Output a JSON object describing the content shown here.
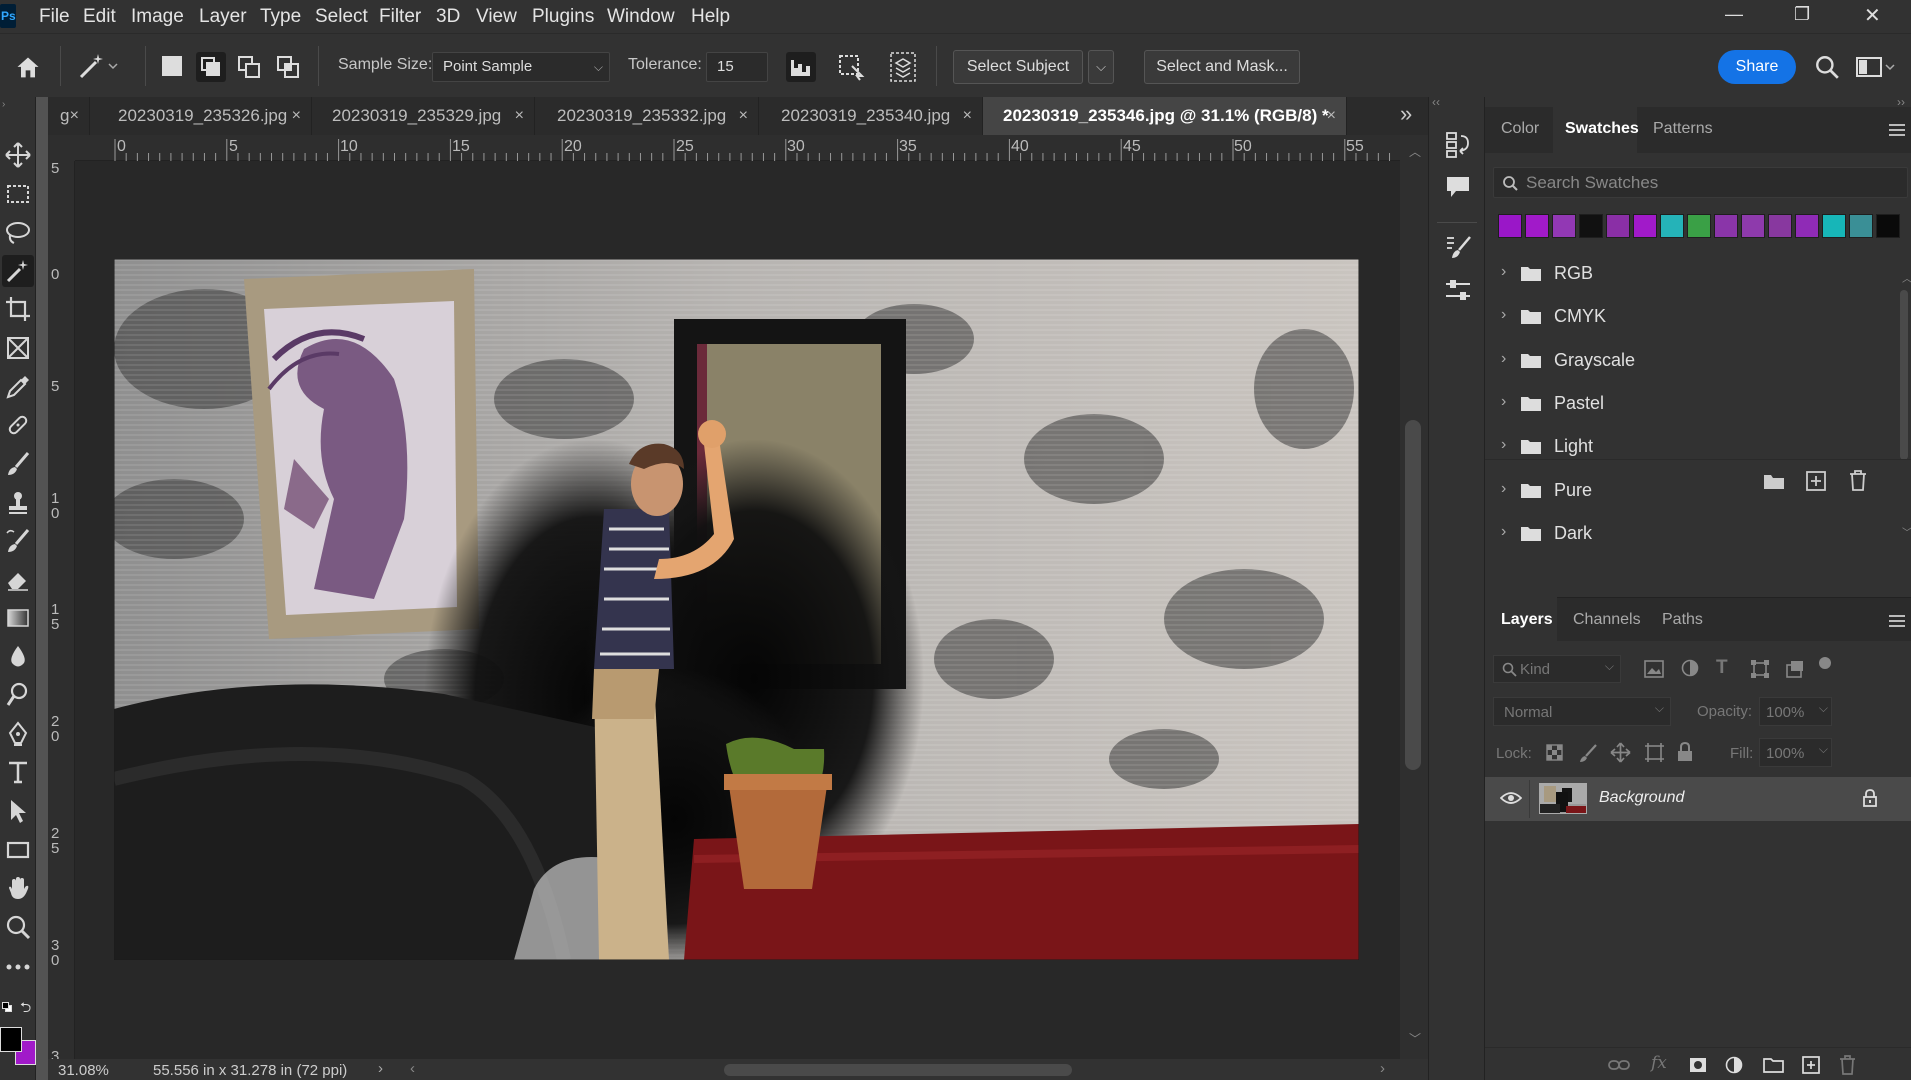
{
  "app": {
    "logo": "Ps"
  },
  "menu": [
    "File",
    "Edit",
    "Image",
    "Layer",
    "Type",
    "Select",
    "Filter",
    "3D",
    "View",
    "Plugins",
    "Window",
    "Help"
  ],
  "window_controls": {
    "minimize": "—",
    "restore": "❐",
    "close": "✕"
  },
  "options": {
    "sample_size_label": "Sample Size:",
    "sample_size_value": "Point Sample",
    "tolerance_label": "Tolerance:",
    "tolerance_value": "15",
    "select_subject": "Select Subject",
    "select_and_mask": "Select and Mask...",
    "share": "Share"
  },
  "tabs": [
    {
      "label": "g"
    },
    {
      "label": "20230319_235326.jpg"
    },
    {
      "label": "20230319_235329.jpg"
    },
    {
      "label": "20230319_235332.jpg"
    },
    {
      "label": "20230319_235340.jpg"
    },
    {
      "label": "20230319_235346.jpg @ 31.1% (RGB/8) *"
    }
  ],
  "tab_close": "×",
  "tab_overflow": "»",
  "ruler": {
    "h_labels": [
      "0",
      "5",
      "10",
      "15",
      "20",
      "25",
      "30",
      "35",
      "40",
      "45",
      "50",
      "55"
    ],
    "v_labels": [
      "5",
      "0",
      "5",
      "1 0",
      "1 5",
      "2 0",
      "2 5",
      "3 0",
      "3"
    ]
  },
  "status": {
    "zoom": "31.08%",
    "doc_size": "55.556 in x 31.278 in (72 ppi)"
  },
  "color_panel": {
    "tabs": [
      "Color",
      "Swatches",
      "Patterns"
    ],
    "search_placeholder": "Search Swatches",
    "swatches": [
      "#9a17c8",
      "#a11ac9",
      "#9238b4",
      "#111111",
      "#8a2fa6",
      "#a11ac9",
      "#25b3b8",
      "#3aa046",
      "#8a35a9",
      "#8e3aac",
      "#88389f",
      "#8f2bb6",
      "#17b6b8",
      "#3a8f96",
      "#0a0a0a"
    ],
    "folders": [
      "RGB",
      "CMYK",
      "Grayscale",
      "Pastel",
      "Light",
      "Pure",
      "Dark"
    ]
  },
  "layers_panel": {
    "tabs": [
      "Layers",
      "Channels",
      "Paths"
    ],
    "kind_label": "Kind",
    "blend_mode": "Normal",
    "opacity_label": "Opacity:",
    "opacity_value": "100%",
    "lock_label": "Lock:",
    "fill_label": "Fill:",
    "fill_value": "100%",
    "layers": [
      {
        "name": "Background"
      }
    ]
  },
  "colors": {
    "accent": "#1473e6",
    "bg": "#323232",
    "canvas": "#282828",
    "foreground": "#000000",
    "background": "#a11ac9"
  }
}
